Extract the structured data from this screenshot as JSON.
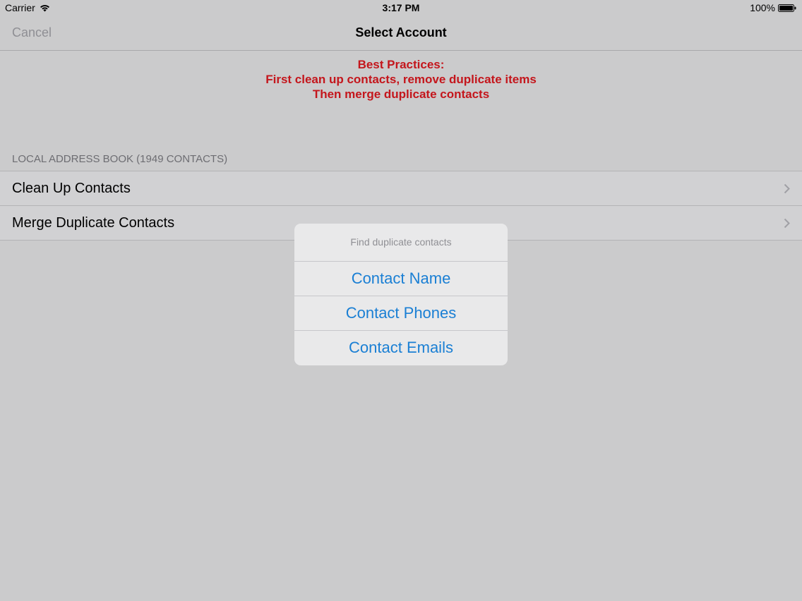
{
  "status_bar": {
    "carrier": "Carrier",
    "time": "3:17 PM",
    "battery": "100%"
  },
  "nav": {
    "cancel_label": "Cancel",
    "title": "Select Account"
  },
  "tips": {
    "line1": "Best Practices:",
    "line2": "First clean up contacts, remove duplicate items",
    "line3": "Then merge duplicate contacts"
  },
  "section": {
    "header": "LOCAL ADDRESS BOOK (1949 CONTACTS)",
    "rows": [
      {
        "label": "Clean Up Contacts"
      },
      {
        "label": "Merge Duplicate Contacts"
      }
    ]
  },
  "sheet": {
    "title": "Find duplicate contacts",
    "options": [
      {
        "label": "Contact Name"
      },
      {
        "label": "Contact Phones"
      },
      {
        "label": "Contact Emails"
      }
    ]
  },
  "colors": {
    "tips_red": "#c4161c",
    "action_blue": "#1a7fd4",
    "background": "#cbcbcc"
  }
}
